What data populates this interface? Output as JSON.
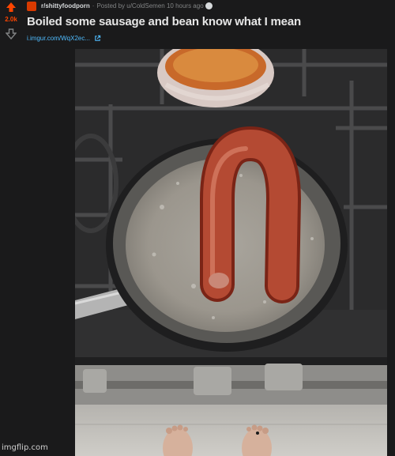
{
  "post": {
    "score": "2.0k",
    "subreddit": "r/shittyfoodporn",
    "posted_by": "Posted by u/ColdSemen 10 hours ago",
    "title": "Boiled some sausage and bean know what I mean",
    "link": "i.imgur.com/WqX2ec..."
  },
  "watermark": "imgflip.com",
  "colors": {
    "background": "#1a1a1b",
    "upvote": "#ff4500",
    "link": "#4fbcff"
  },
  "icons": [
    "upvote-arrow-icon",
    "downvote-arrow-icon",
    "subreddit-icon",
    "award-icon",
    "external-link-icon"
  ]
}
